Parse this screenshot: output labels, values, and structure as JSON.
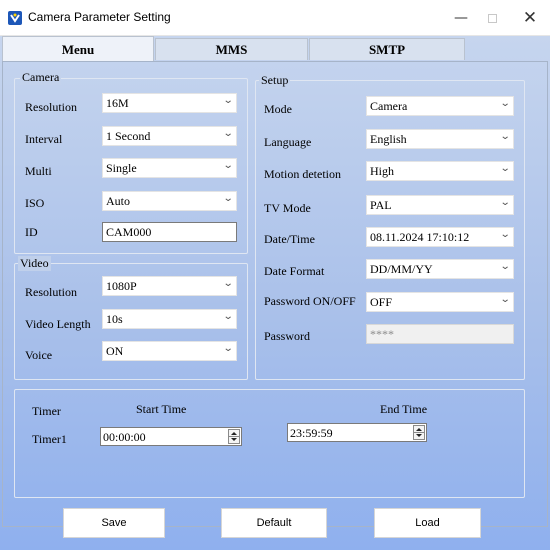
{
  "window": {
    "title": "Camera Parameter Setting",
    "min_glyph": "—",
    "close_glyph": "✕"
  },
  "tabs": [
    "Menu",
    "MMS",
    "SMTP"
  ],
  "camera": {
    "title": "Camera",
    "fields": [
      {
        "label": "Resolution",
        "value": "16M"
      },
      {
        "label": "Interval",
        "value": "1 Second"
      },
      {
        "label": "Multi",
        "value": "Single"
      },
      {
        "label": "ISO",
        "value": "Auto"
      }
    ],
    "id_label": "ID",
    "id_value": "CAM000"
  },
  "video": {
    "title": "Video",
    "fields": [
      {
        "label": "Resolution",
        "value": "1080P"
      },
      {
        "label": "Video Length",
        "value": "10s"
      },
      {
        "label": "Voice",
        "value": "ON"
      }
    ]
  },
  "setup": {
    "title": "Setup",
    "fields": [
      {
        "label": "Mode",
        "value": "Camera"
      },
      {
        "label": "Language",
        "value": "English"
      },
      {
        "label": "Motion detetion",
        "value": "High"
      },
      {
        "label": "TV Mode",
        "value": "PAL"
      },
      {
        "label": "Date/Time",
        "value": "08.11.2024 17:10:12"
      },
      {
        "label": "Date Format",
        "value": "DD/MM/YY"
      },
      {
        "label": "Password ON/OFF",
        "value": "OFF"
      }
    ],
    "password_label": "Password",
    "password_value": "****"
  },
  "timer": {
    "title": "Timer",
    "start_header": "Start Time",
    "end_header": "End Time",
    "row_label": "Timer1",
    "start_value": "00:00:00",
    "end_value": "23:59:59"
  },
  "buttons": {
    "save": "Save",
    "default": "Default",
    "load": "Load"
  },
  "colors": {
    "background_top": "#c6d5ee",
    "background_bottom": "#8fb0ee",
    "app_icon": "#1d57b8"
  }
}
